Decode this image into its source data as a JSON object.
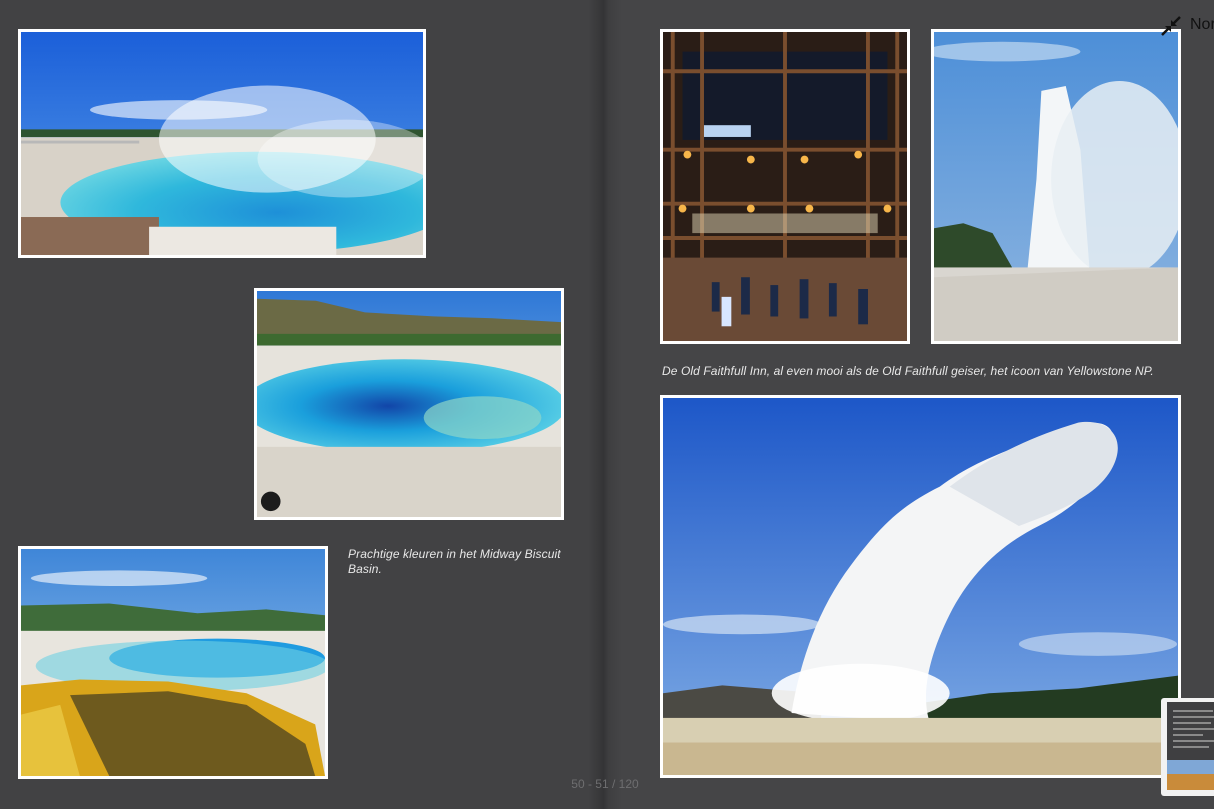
{
  "header": {
    "normal_view_label": "Normaal"
  },
  "left_page": {
    "caption": "Prachtige kleuren in het Midway Biscuit Basin."
  },
  "right_page": {
    "caption": "De Old Faithfull Inn, al even mooi als de Old Faithfull geiser, het icoon van Yellowstone NP."
  },
  "footer": {
    "page_indicator": "50 - 51 / 120"
  },
  "icons": {
    "normal_view": "shrink-arrows-icon"
  },
  "colors": {
    "page_bg": "#434345",
    "caption_text": "#e8e8e8",
    "photo_border": "#ffffff"
  }
}
